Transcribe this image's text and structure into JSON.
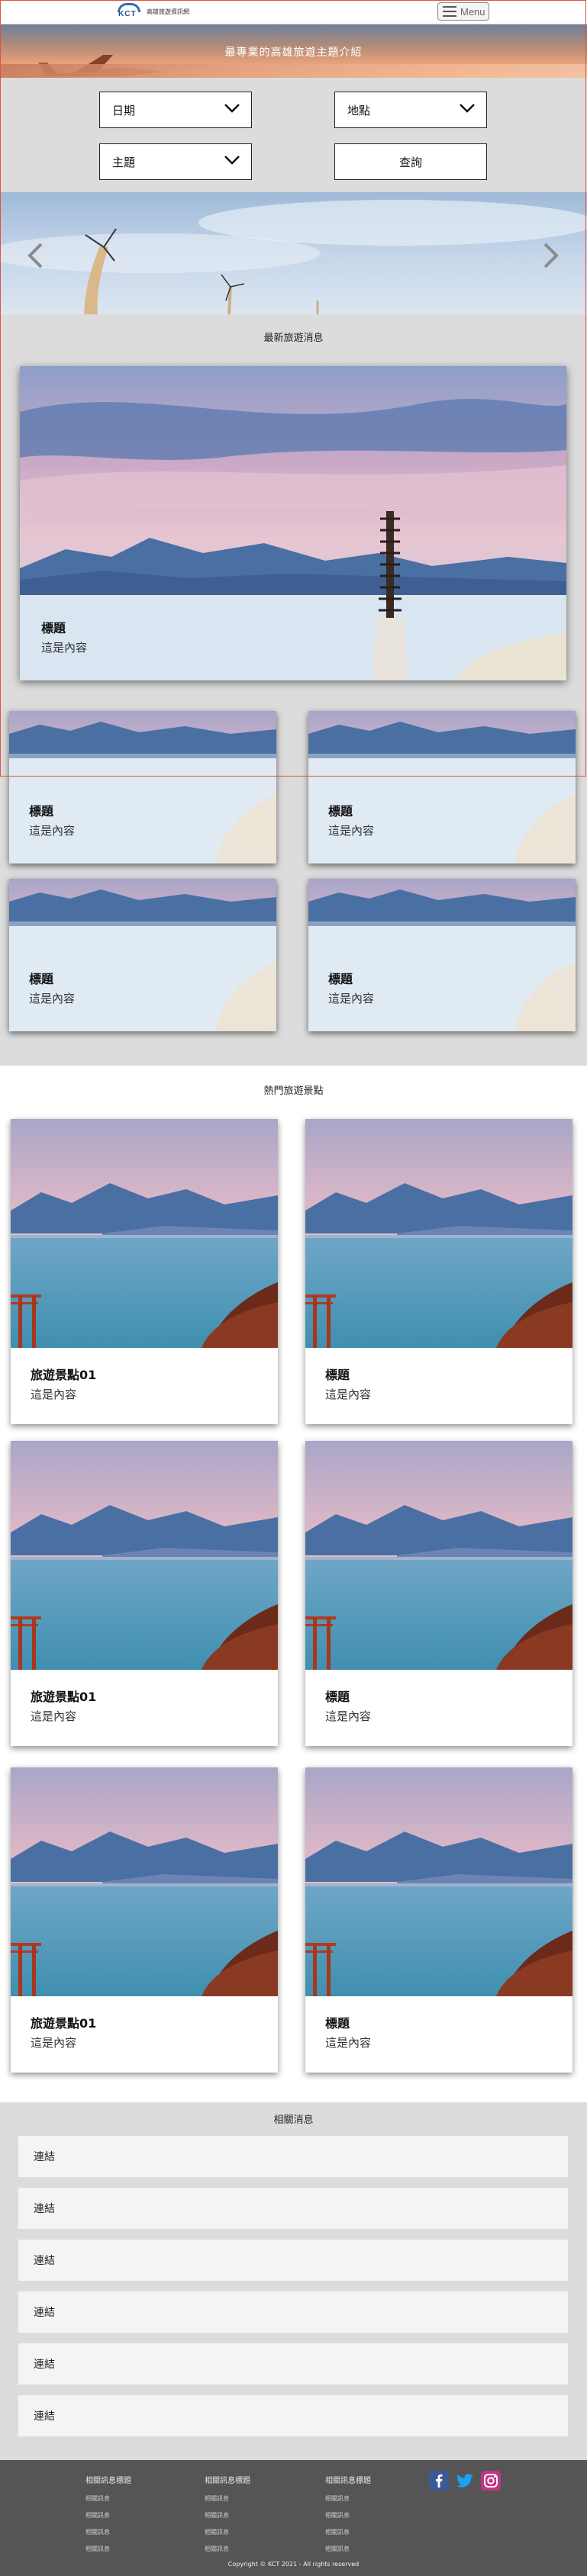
{
  "header": {
    "logo_mark": "KCT",
    "logo_name": "高雄旅遊資訊網",
    "menu_label": "Menu"
  },
  "banner": {
    "slogan": "最專業的高雄旅遊主題介紹"
  },
  "search": {
    "date_label": "日期",
    "place_label": "地點",
    "theme_label": "主題",
    "query_label": "查詢"
  },
  "news": {
    "section_title": "最新旅遊消息",
    "hero": {
      "title": "標題",
      "body": "這是內容"
    },
    "cards": [
      {
        "title": "標題",
        "body": "這是內容"
      },
      {
        "title": "標題",
        "body": "這是內容"
      },
      {
        "title": "標題",
        "body": "這是內容"
      },
      {
        "title": "標題",
        "body": "這是內容"
      }
    ]
  },
  "attractions": {
    "section_title": "熱門旅遊景點",
    "cards": [
      {
        "title": "旅遊景點01",
        "body": "這是內容"
      },
      {
        "title": "標題",
        "body": "這是內容"
      },
      {
        "title": "旅遊景點01",
        "body": "這是內容"
      },
      {
        "title": "標題",
        "body": "這是內容"
      },
      {
        "title": "旅遊景點01",
        "body": "這是內容"
      },
      {
        "title": "標題",
        "body": "這是內容"
      }
    ]
  },
  "related": {
    "section_title": "相關消息",
    "items": [
      "連結",
      "連結",
      "連結",
      "連結",
      "連結",
      "連結"
    ]
  },
  "footer": {
    "columns": [
      {
        "heading": "相關訊息標題",
        "links": [
          "相關訊息",
          "相關訊息",
          "相關訊息",
          "相關訊息"
        ]
      },
      {
        "heading": "相關訊息標題",
        "links": [
          "相關訊息",
          "相關訊息",
          "相關訊息",
          "相關訊息"
        ]
      },
      {
        "heading": "相關訊息標題",
        "links": [
          "相關訊息",
          "相關訊息",
          "相關訊息",
          "相關訊息"
        ]
      }
    ],
    "social_icons": [
      "facebook-icon",
      "twitter-icon",
      "instagram-icon"
    ],
    "copyright": "Copyright © KCT 2021 - All rights reserved"
  },
  "colors": {
    "panel_gray": "#dcdcdc",
    "footer_gray": "#555555",
    "facebook": "#3b5998",
    "twitter": "#1da1f2",
    "instagram": "#c13584",
    "guide_red": "#e0523c"
  }
}
